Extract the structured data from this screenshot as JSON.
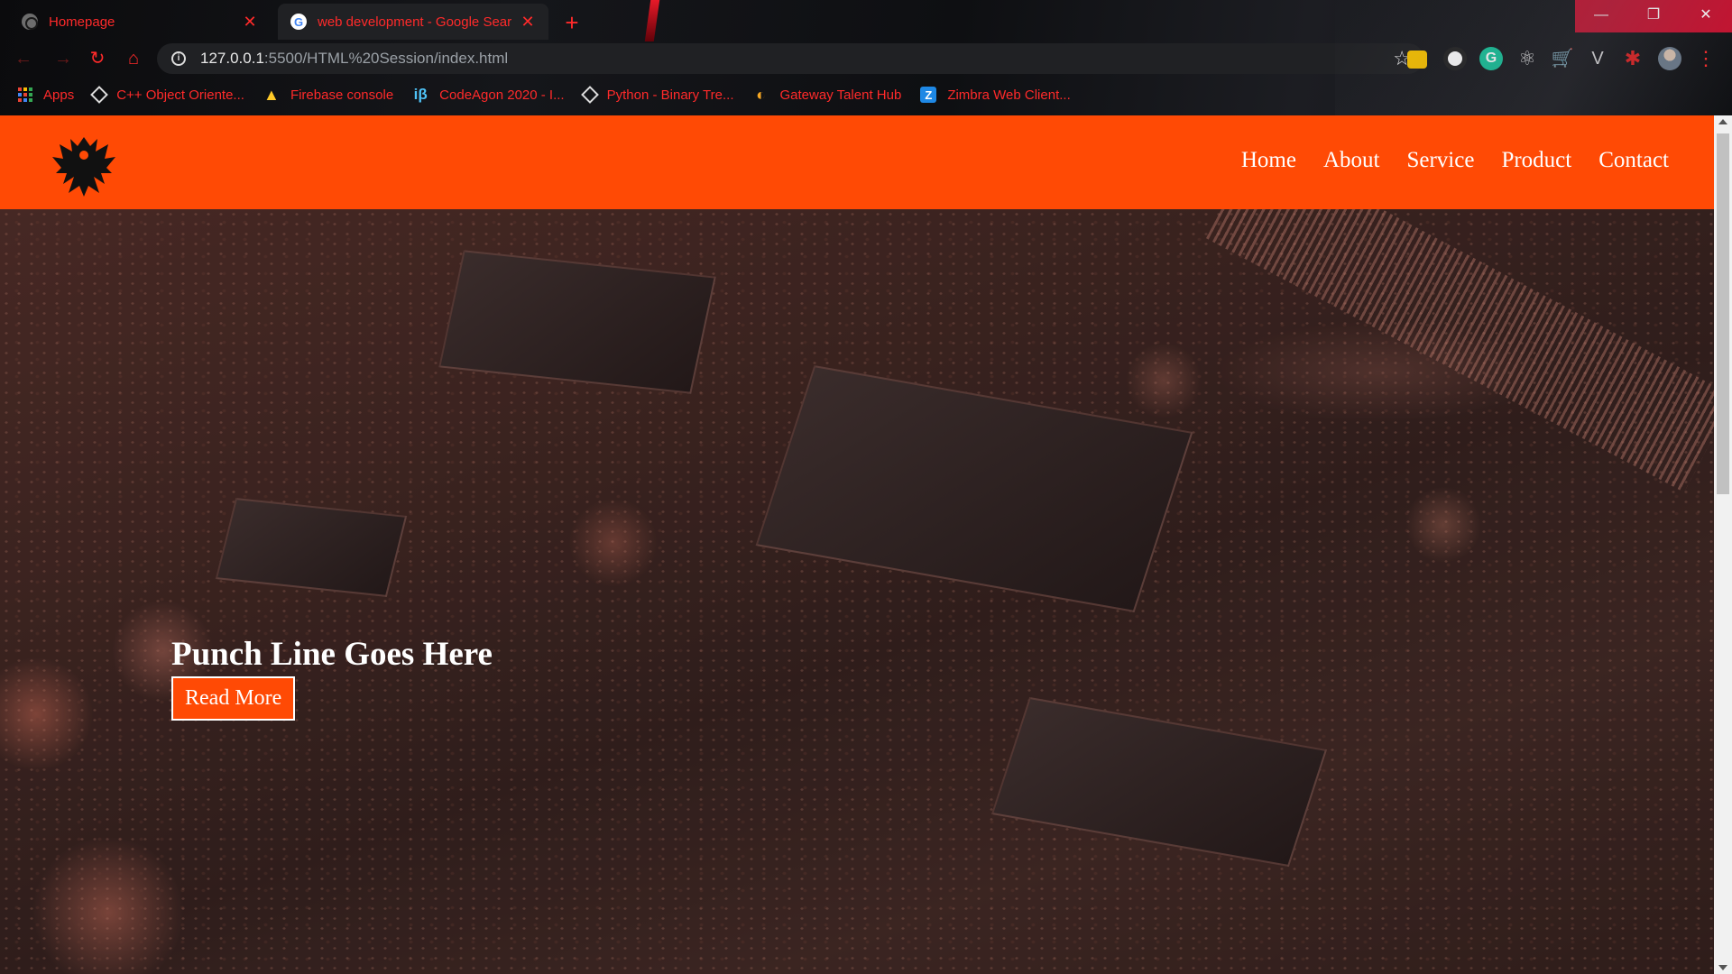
{
  "browser": {
    "tabs": [
      {
        "title": "Homepage",
        "close": "✕"
      },
      {
        "title": "web development - Google Sear",
        "close": "✕"
      }
    ],
    "new_tab": "+",
    "window_controls": {
      "minimize": "—",
      "restore": "❐",
      "close": "✕"
    },
    "nav": {
      "back": "←",
      "forward": "→",
      "reload": "↻",
      "home": "⌂"
    },
    "address": {
      "host": "127.0.0.1",
      "rest": ":5500/HTML%20Session/index.html",
      "info_icon": "i",
      "star": "☆"
    },
    "bookmarks": [
      {
        "label": "Apps",
        "icon": "apps-grid"
      },
      {
        "label": "C++ Object Oriente...",
        "icon": "diamond"
      },
      {
        "label": "Firebase console",
        "icon": "firebase"
      },
      {
        "label": "CodeAgon 2020 - I...",
        "icon": "ib",
        "glyph": "iβ"
      },
      {
        "label": "Python - Binary Tre...",
        "icon": "diamond"
      },
      {
        "label": "Gateway Talent Hub",
        "icon": "gateway"
      },
      {
        "label": "Zimbra Web Client...",
        "icon": "zimbra",
        "glyph": "Z"
      }
    ],
    "extensions": {
      "grammarly": "G",
      "react": "⚛",
      "cart": "🛒",
      "vimeo": "V",
      "puzzle": "✱",
      "menu": "⋮"
    }
  },
  "site": {
    "colors": {
      "navbar": "#ff4a05",
      "text": "#ffffff"
    },
    "menu": [
      "Home",
      "About",
      "Service",
      "Product",
      "Contact"
    ],
    "hero": {
      "headline": "Punch Line Goes Here",
      "cta": "Read More"
    }
  }
}
